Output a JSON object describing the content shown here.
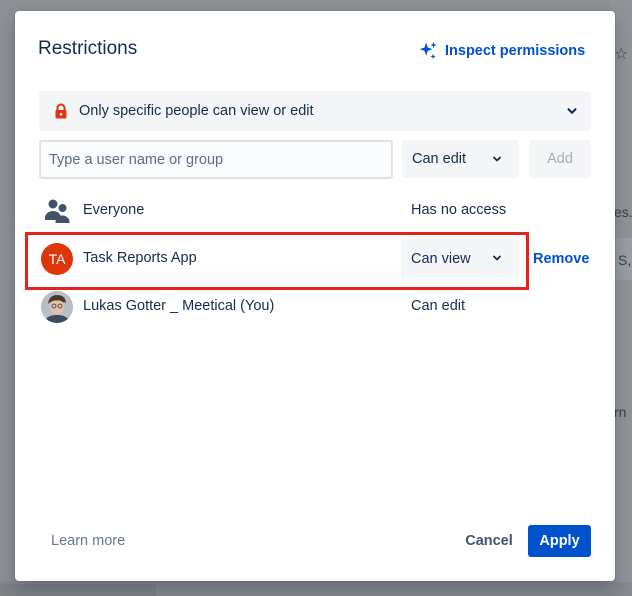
{
  "background": {
    "frag_1": "es.",
    "frag_2": "S,",
    "frag_3": "rn"
  },
  "modal": {
    "title": "Restrictions",
    "inspect_label": "Inspect permissions",
    "restriction_mode": "Only specific people can view or edit",
    "user_input_placeholder": "Type a user name or group",
    "new_permission": "Can edit",
    "add_label": "Add",
    "entries": [
      {
        "name": "Everyone",
        "access": "Has no access"
      },
      {
        "name": "Task Reports App",
        "initials": "TA",
        "access": "Can view",
        "action": "Remove"
      },
      {
        "name": "Lukas Gotter _ Meetical (You)",
        "access": "Can edit"
      }
    ],
    "learn_more": "Learn more",
    "cancel_label": "Cancel",
    "apply_label": "Apply"
  },
  "colors": {
    "primary": "#0052cc",
    "avatar_ta": "#de350b",
    "lock": "#de350b",
    "highlight": "#e8221b"
  }
}
